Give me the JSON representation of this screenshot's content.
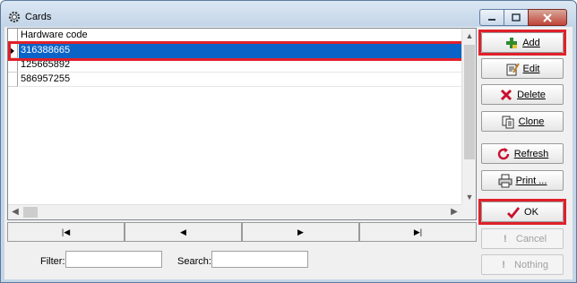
{
  "window": {
    "title": "Cards"
  },
  "grid": {
    "header": "Hardware code",
    "rows": [
      {
        "value": "316388665",
        "selected": true
      },
      {
        "value": "125665892",
        "selected": false
      },
      {
        "value": "586957255",
        "selected": false
      }
    ]
  },
  "navigator": {
    "first": "|◀",
    "prev": "◀",
    "next": "▶",
    "last": "▶|"
  },
  "filter": {
    "label": "Filter:",
    "value": ""
  },
  "search": {
    "label": "Search:",
    "value": ""
  },
  "buttons": {
    "add": "Add",
    "edit": "Edit",
    "delete": "Delete",
    "clone": "Clone",
    "refresh": "Refresh",
    "print": "Print ...",
    "ok": "OK",
    "cancel": "Cancel",
    "nothing": "Nothing"
  },
  "icons": {
    "add": "plus-icon",
    "edit": "edit-icon",
    "delete": "x-icon",
    "clone": "clone-icon",
    "refresh": "refresh-icon",
    "print": "printer-icon",
    "ok": "checkmark-icon",
    "cancel": "exclamation-icon",
    "nothing": "exclamation-icon"
  },
  "colors": {
    "selection": "#0a64c8",
    "highlight": "#e0202a",
    "ok_check": "#c8102e",
    "add_plus": "#2e8b2e"
  }
}
